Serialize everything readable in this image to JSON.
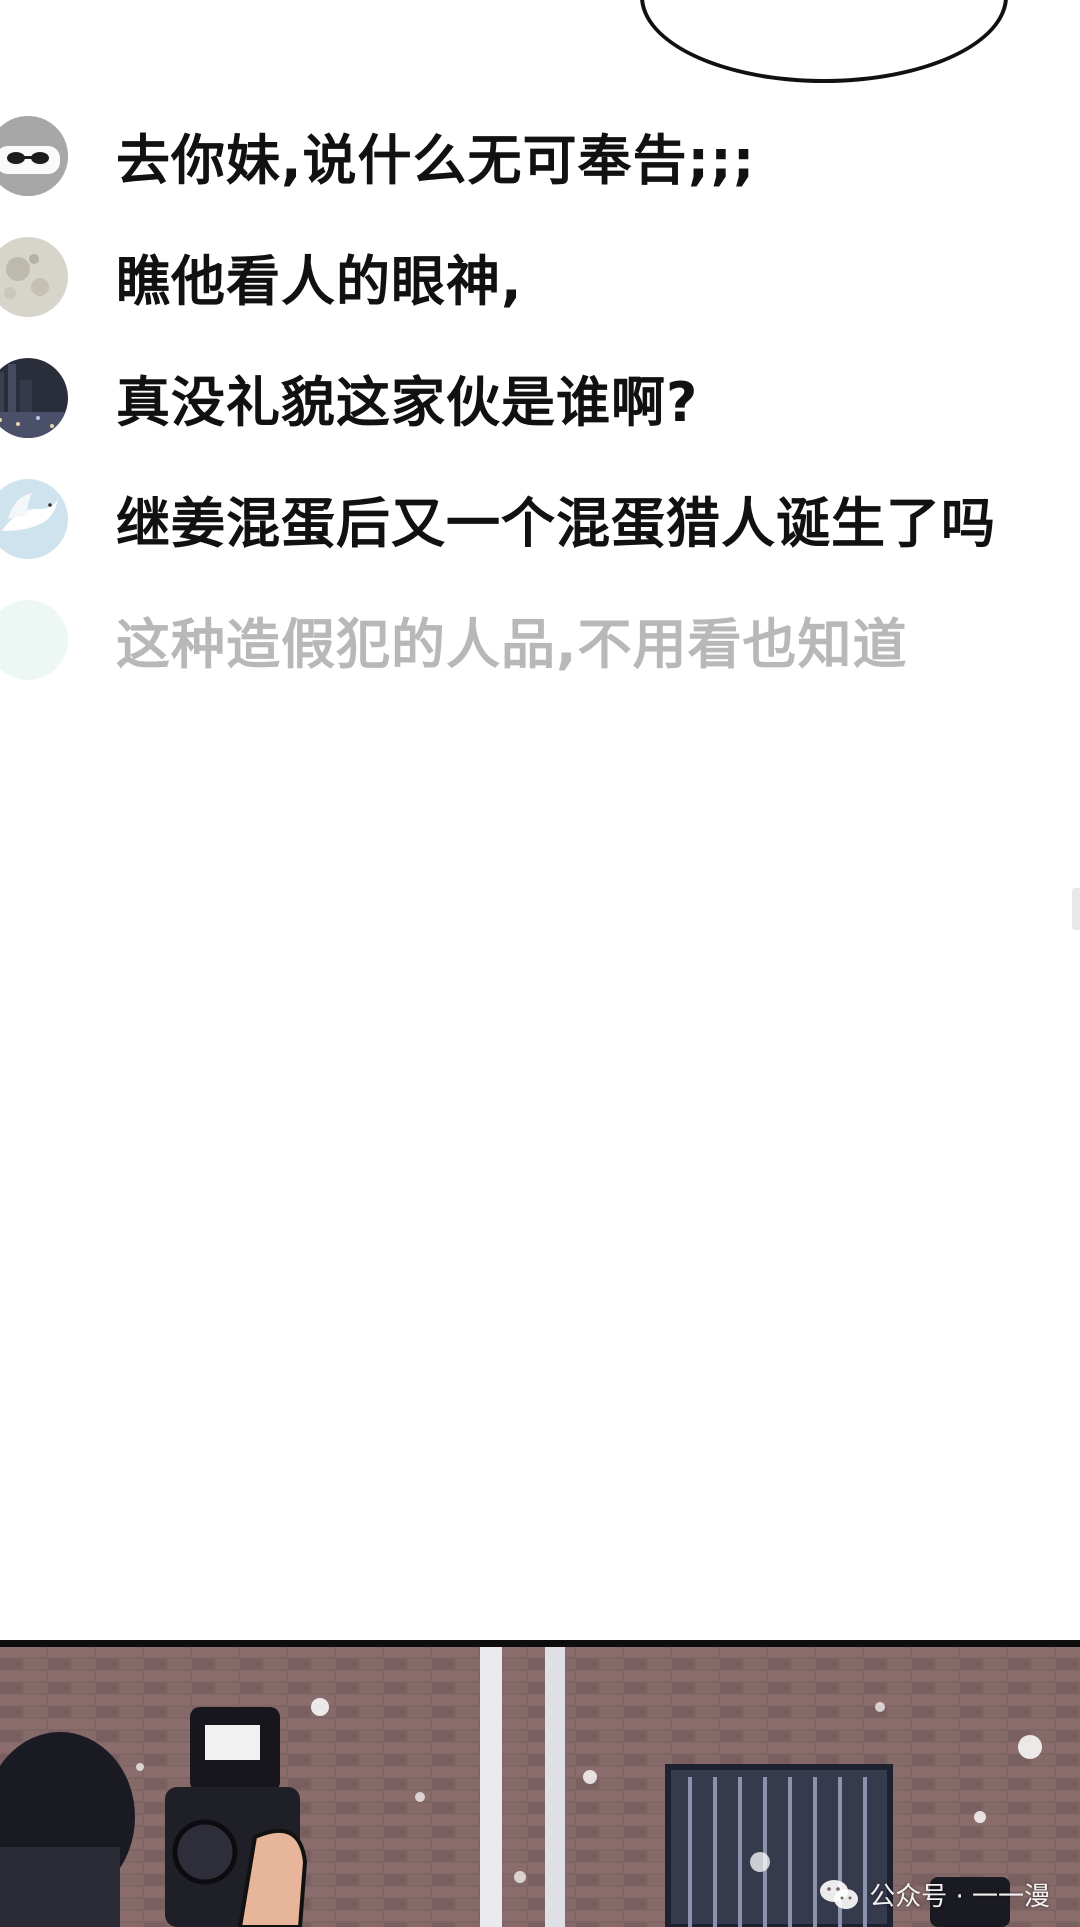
{
  "comments": [
    {
      "avatar": "sunglasses-avatar",
      "text": "去你妹,说什么无可奉告;;;"
    },
    {
      "avatar": "moon-avatar",
      "text": "瞧他看人的眼神,"
    },
    {
      "avatar": "night-city-avatar",
      "text": "真没礼貌这家伙是谁啊?"
    },
    {
      "avatar": "white-bird-avatar",
      "text": "继姜混蛋后又一个混蛋猎人诞生了吗"
    },
    {
      "avatar": "pale-teal-avatar",
      "text": "这种造假犯的人品,不用看也知道"
    }
  ],
  "watermark": {
    "icon": "wechat-icon",
    "text": "公众号 · 一一漫"
  },
  "colors": {
    "text": "#111111",
    "faded_text": "#b8b8b8",
    "brick_wall": "#7c6262",
    "panel_border": "#0d0d0d"
  }
}
